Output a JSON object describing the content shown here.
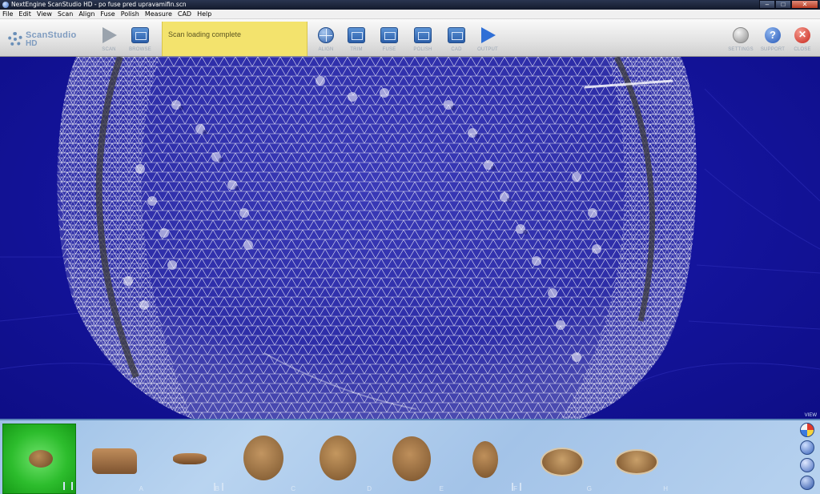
{
  "window": {
    "title": "NextEngine ScanStudio HD - po fuse pred upravamifin.scn",
    "controls": {
      "minimize": "–",
      "maximize": "□",
      "close": "✕"
    }
  },
  "menu": [
    "File",
    "Edit",
    "View",
    "Scan",
    "Align",
    "Fuse",
    "Polish",
    "Measure",
    "CAD",
    "Help"
  ],
  "logo": {
    "name": "ScanStudio",
    "suffix": "HD"
  },
  "toolbar": {
    "scan": "SCAN",
    "browse": "BROWSE",
    "status": "Scan loading complete",
    "align": "ALIGN",
    "trim": "TRIM",
    "fuse": "FUSE",
    "polish": "POLISH",
    "cad": "CAD",
    "output": "OUTPUT",
    "settings": "SETTINGS",
    "support": "SUPPORT",
    "close": "CLOSE",
    "help_glyph": "?",
    "close_glyph": "✕"
  },
  "viewport": {
    "background_color": "#1616a2",
    "mesh_color": "#ffffff"
  },
  "strip": {
    "view_label": "VIEW",
    "thumbnails": [
      {
        "letter": "",
        "active": true
      },
      {
        "letter": "A",
        "active": false
      },
      {
        "letter": "B",
        "active": false
      },
      {
        "letter": "C",
        "active": false
      },
      {
        "letter": "D",
        "active": false
      },
      {
        "letter": "E",
        "active": false
      },
      {
        "letter": "F",
        "active": false
      },
      {
        "letter": "G",
        "active": false
      },
      {
        "letter": "H",
        "active": false
      }
    ]
  }
}
